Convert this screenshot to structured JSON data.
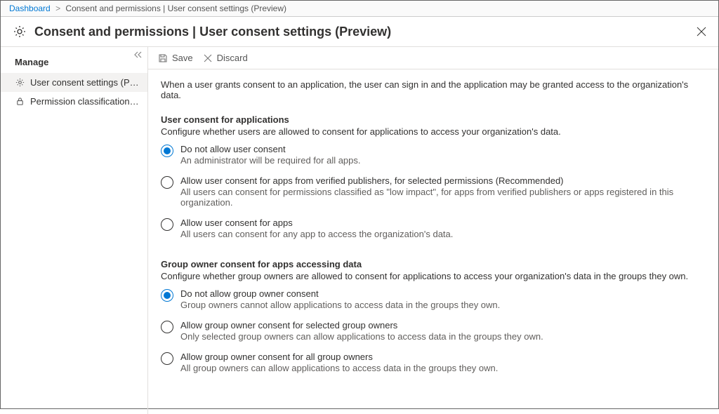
{
  "breadcrumb": {
    "root": "Dashboard",
    "current": "Consent and permissions | User consent settings (Preview)"
  },
  "header": {
    "title": "Consent and permissions | User consent settings (Preview)"
  },
  "sidebar": {
    "heading": "Manage",
    "items": [
      {
        "label": "User consent settings (Preview)"
      },
      {
        "label": "Permission classifications (Previ..."
      }
    ]
  },
  "toolbar": {
    "save": "Save",
    "discard": "Discard"
  },
  "intro": "When a user grants consent to an application, the user can sign in and the application may be granted access to the organization's data.",
  "section1": {
    "title": "User consent for applications",
    "desc": "Configure whether users are allowed to consent for applications to access your organization's data.",
    "options": [
      {
        "label": "Do not allow user consent",
        "help": "An administrator will be required for all apps.",
        "selected": true
      },
      {
        "label": "Allow user consent for apps from verified publishers, for selected permissions (Recommended)",
        "help": "All users can consent for permissions classified as \"low impact\", for apps from verified publishers or apps registered in this organization.",
        "selected": false
      },
      {
        "label": "Allow user consent for apps",
        "help": "All users can consent for any app to access the organization's data.",
        "selected": false
      }
    ]
  },
  "section2": {
    "title": "Group owner consent for apps accessing data",
    "desc": "Configure whether group owners are allowed to consent for applications to access your organization's data in the groups they own.",
    "options": [
      {
        "label": "Do not allow group owner consent",
        "help": "Group owners cannot allow applications to access data in the groups they own.",
        "selected": true
      },
      {
        "label": "Allow group owner consent for selected group owners",
        "help": "Only selected group owners can allow applications to access data in the groups they own.",
        "selected": false
      },
      {
        "label": "Allow group owner consent for all group owners",
        "help": "All group owners can allow applications to access data in the groups they own.",
        "selected": false
      }
    ]
  }
}
